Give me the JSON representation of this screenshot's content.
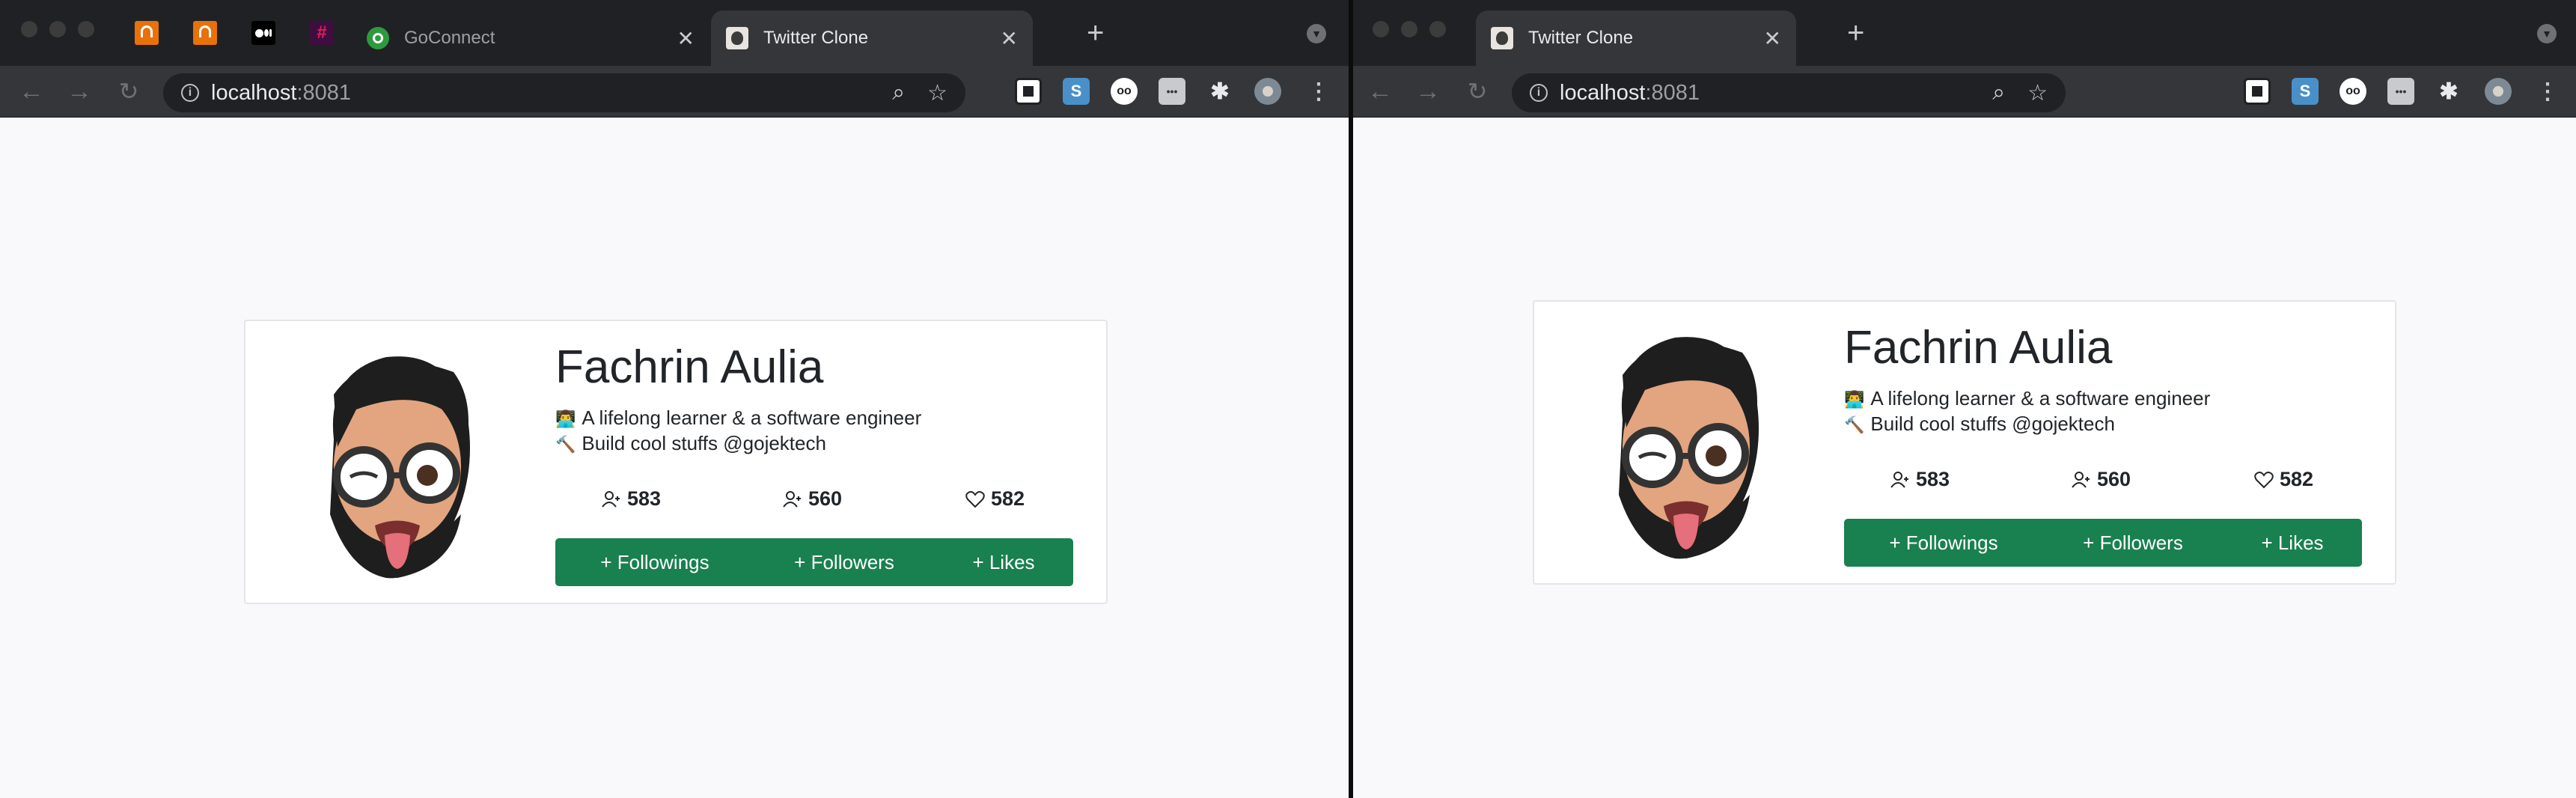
{
  "colors": {
    "accent": "#198050",
    "chrome_dark": "#202124",
    "toolbar": "#35363a",
    "page_bg": "#f9f9fc"
  },
  "left_window": {
    "tabs": [
      {
        "title": "GoConnect",
        "icon": "goconnect-icon"
      },
      {
        "title": "Twitter Clone",
        "icon": "twitter-clone-favicon"
      }
    ],
    "address": {
      "host": "localhost",
      "port": ":8081"
    }
  },
  "right_window": {
    "tabs": [
      {
        "title": "Twitter Clone",
        "icon": "twitter-clone-favicon"
      }
    ],
    "address": {
      "host": "localhost",
      "port": ":8081"
    }
  },
  "profile": {
    "name": "Fachrin Aulia",
    "bio_emoji_1": "👨‍💻",
    "bio_line_1": "A lifelong learner & a software engineer",
    "bio_emoji_2": "🔨",
    "bio_line_2": "Build cool stuffs @gojektech",
    "stats": {
      "followings": "583",
      "followers": "560",
      "likes": "582"
    },
    "actions": {
      "followings": "+ Followings",
      "followers": "+ Followers",
      "likes": "+ Likes"
    }
  }
}
